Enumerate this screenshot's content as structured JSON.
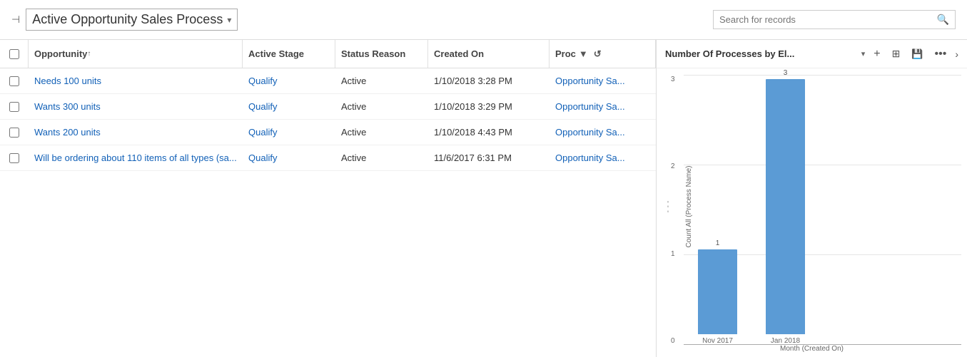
{
  "header": {
    "pin_icon": "📌",
    "title": "Active Opportunity Sales Process",
    "dropdown_icon": "▾",
    "search_placeholder": "Search for records",
    "search_icon": "🔍"
  },
  "grid": {
    "columns": [
      {
        "id": "checkbox",
        "label": ""
      },
      {
        "id": "opportunity",
        "label": "Opportunity",
        "sort": "↑"
      },
      {
        "id": "active_stage",
        "label": "Active Stage"
      },
      {
        "id": "status_reason",
        "label": "Status Reason"
      },
      {
        "id": "created_on",
        "label": "Created On"
      },
      {
        "id": "process",
        "label": "Proc"
      }
    ],
    "rows": [
      {
        "opportunity": "Needs 100 units",
        "active_stage": "Qualify",
        "status_reason": "Active",
        "created_on": "1/10/2018 3:28 PM",
        "process": "Opportunity Sa..."
      },
      {
        "opportunity": "Wants 300 units",
        "active_stage": "Qualify",
        "status_reason": "Active",
        "created_on": "1/10/2018 3:29 PM",
        "process": "Opportunity Sa..."
      },
      {
        "opportunity": "Wants 200 units",
        "active_stage": "Qualify",
        "status_reason": "Active",
        "created_on": "1/10/2018 4:43 PM",
        "process": "Opportunity Sa..."
      },
      {
        "opportunity": "Will be ordering about 110 items of all types (sa...",
        "active_stage": "Qualify",
        "status_reason": "Active",
        "created_on": "11/6/2017 6:31 PM",
        "process": "Opportunity Sa..."
      }
    ]
  },
  "chart": {
    "title": "Number Of Processes by El...",
    "dropdown_icon": "▾",
    "actions": {
      "add": "+",
      "layout": "⊞",
      "save": "💾",
      "more": "•••",
      "nav": "›"
    },
    "y_axis_label": "Count All (Process Name)",
    "x_axis_label": "Month (Created On)",
    "y_ticks": [
      "0",
      "1",
      "2",
      "3"
    ],
    "bars": [
      {
        "label": "Nov 2017",
        "value": 1,
        "display_value": "1"
      },
      {
        "label": "Jan 2018",
        "value": 3,
        "display_value": "3"
      }
    ],
    "bar_color": "#5b9bd5",
    "max_value": 3
  }
}
